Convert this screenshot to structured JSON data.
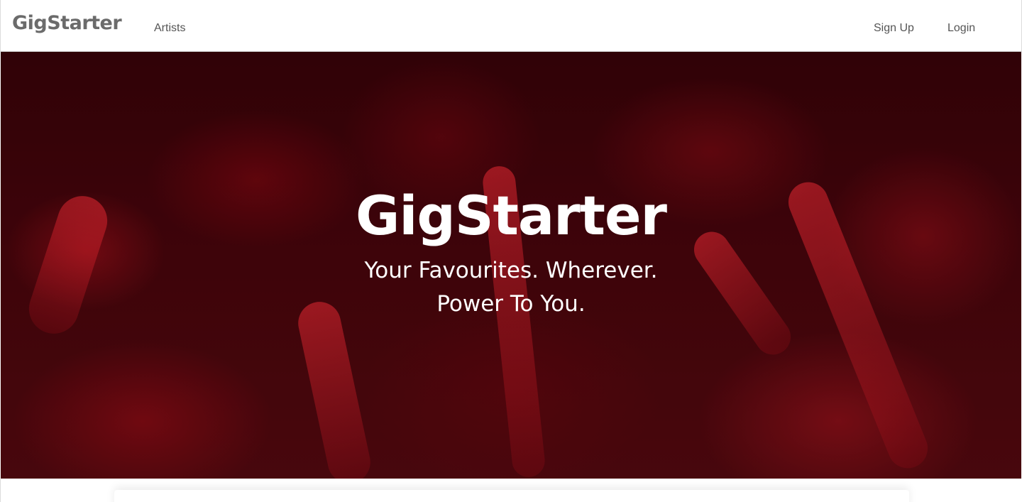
{
  "navbar": {
    "brand": "GigStarter",
    "links": [
      {
        "label": "Artists"
      },
      {
        "label": "Sign Up"
      },
      {
        "label": "Login"
      }
    ]
  },
  "hero": {
    "title": "GigStarter",
    "tagline_1": "Your Favourites. Wherever.",
    "tagline_2": "Power To You.",
    "background_color": "#4a050c",
    "accent_color": "#c8141e"
  }
}
